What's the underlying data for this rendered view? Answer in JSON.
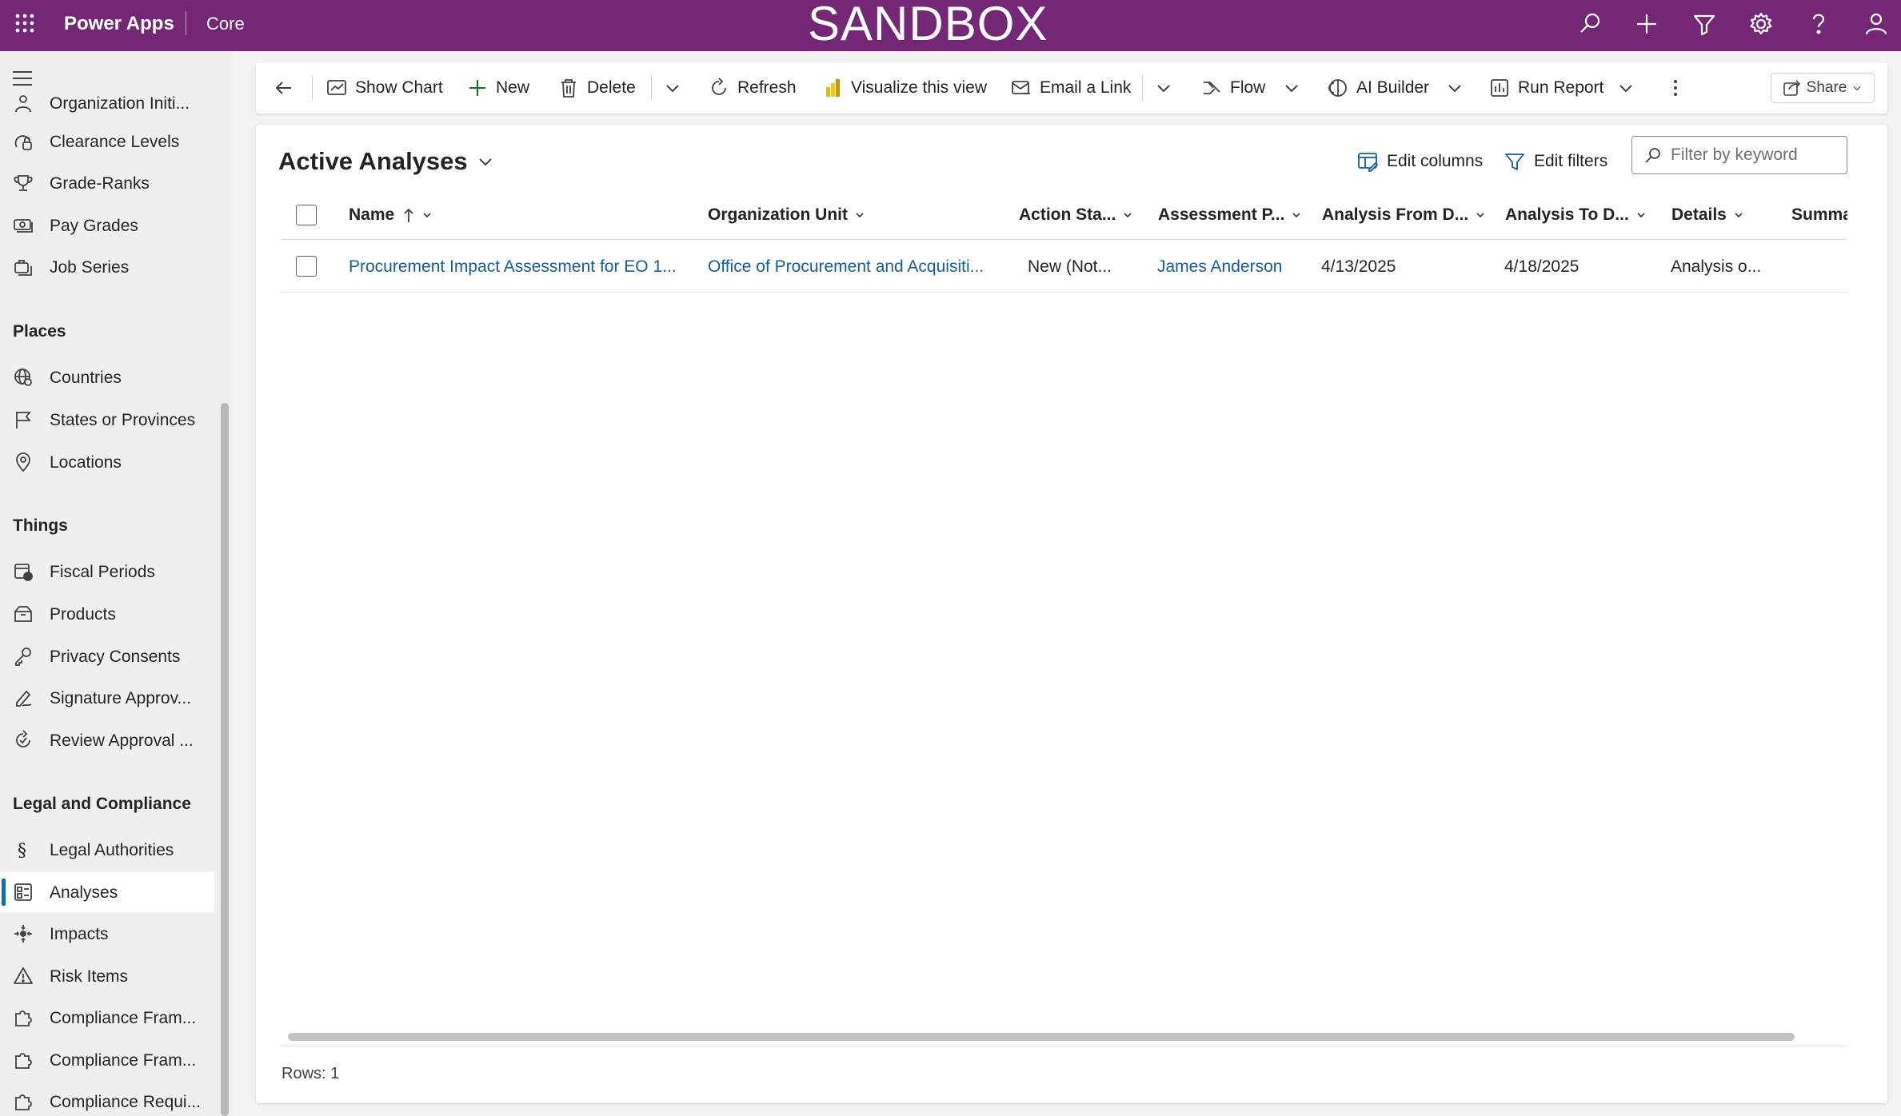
{
  "topbar": {
    "app_name": "Power Apps",
    "environment": "Core",
    "banner": "SANDBOX",
    "bg_color": "#742774",
    "icons": [
      "search-icon",
      "plus-icon",
      "filter-icon",
      "gear-icon",
      "help-icon",
      "person-icon"
    ]
  },
  "sidebar": {
    "items_top": [
      {
        "label": "Organization Initi...",
        "icon": "organization-icon"
      },
      {
        "label": "Clearance Levels",
        "icon": "lock-badge-icon"
      },
      {
        "label": "Grade-Ranks",
        "icon": "trophy-icon"
      },
      {
        "label": "Pay Grades",
        "icon": "money-icon"
      },
      {
        "label": "Job Series",
        "icon": "briefcase-stack-icon"
      }
    ],
    "group_places": "Places",
    "items_places": [
      {
        "label": "Countries",
        "icon": "globe-icon"
      },
      {
        "label": "States or Provinces",
        "icon": "flag-icon"
      },
      {
        "label": "Locations",
        "icon": "location-pin-icon"
      }
    ],
    "group_things": "Things",
    "items_things": [
      {
        "label": "Fiscal Periods",
        "icon": "calendar-icon"
      },
      {
        "label": "Products",
        "icon": "box-icon"
      },
      {
        "label": "Privacy Consents",
        "icon": "key-icon"
      },
      {
        "label": "Signature Approv...",
        "icon": "signature-icon"
      },
      {
        "label": "Review Approval ...",
        "icon": "review-cycle-icon"
      }
    ],
    "group_legal": "Legal and Compliance",
    "items_legal": [
      {
        "label": "Legal Authorities",
        "icon": "section-icon"
      },
      {
        "label": "Analyses",
        "icon": "analyses-icon",
        "active": true
      },
      {
        "label": "Impacts",
        "icon": "impact-icon"
      },
      {
        "label": "Risk Items",
        "icon": "warning-icon"
      },
      {
        "label": "Compliance Fram...",
        "icon": "puzzle-icon"
      },
      {
        "label": "Compliance Fram...",
        "icon": "puzzle-icon"
      },
      {
        "label": "Compliance Requi...",
        "icon": "puzzle-icon"
      }
    ]
  },
  "commandbar": {
    "show_chart": "Show Chart",
    "new": "New",
    "delete": "Delete",
    "refresh": "Refresh",
    "visualize": "Visualize this view",
    "email_link": "Email a Link",
    "flow": "Flow",
    "ai_builder": "AI Builder",
    "run_report": "Run Report",
    "share": "Share"
  },
  "view": {
    "title": "Active Analyses",
    "edit_columns": "Edit columns",
    "edit_filters": "Edit filters",
    "filter_placeholder": "Filter by keyword"
  },
  "grid": {
    "columns": [
      "Name",
      "Organization Unit",
      "Action Sta...",
      "Assessment P...",
      "Analysis From D...",
      "Analysis To D...",
      "Details",
      "Summa"
    ],
    "rows": [
      {
        "name": "Procurement Impact Assessment for EO 1...",
        "org_unit": "Office of Procurement and Acquisiti...",
        "action_status": "New (Not...",
        "assessment_person": "James Anderson",
        "from_date": "4/13/2025",
        "to_date": "4/18/2025",
        "details": "Analysis o...",
        "summary": ""
      }
    ],
    "row_count": "Rows: 1"
  }
}
